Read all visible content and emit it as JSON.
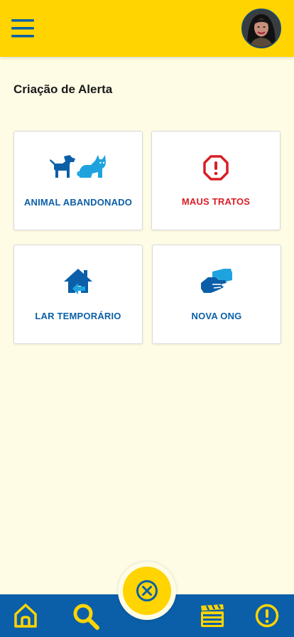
{
  "header": {
    "menu_icon": "hamburger-menu-icon",
    "avatar": "user-avatar"
  },
  "page": {
    "title": "Criação de Alerta"
  },
  "cards": [
    {
      "label": "ANIMAL ABANDONADO",
      "icon": "dog-cat-icon"
    },
    {
      "label": "MAUS TRATOS",
      "icon": "alert-octagon-icon"
    },
    {
      "label": "LAR TEMPORÁRIO",
      "icon": "home-icon"
    },
    {
      "label": "NOVA ONG",
      "icon": "handshake-icon"
    }
  ],
  "bottom_nav": {
    "items": [
      "home-icon",
      "search-icon",
      "video-icon",
      "alert-circle-icon"
    ],
    "center_action": "close-circle-icon"
  },
  "colors": {
    "primary_yellow": "#FFD400",
    "primary_blue": "#0B5FA8",
    "alert_red": "#D81F26",
    "background": "#FFFCE6"
  }
}
